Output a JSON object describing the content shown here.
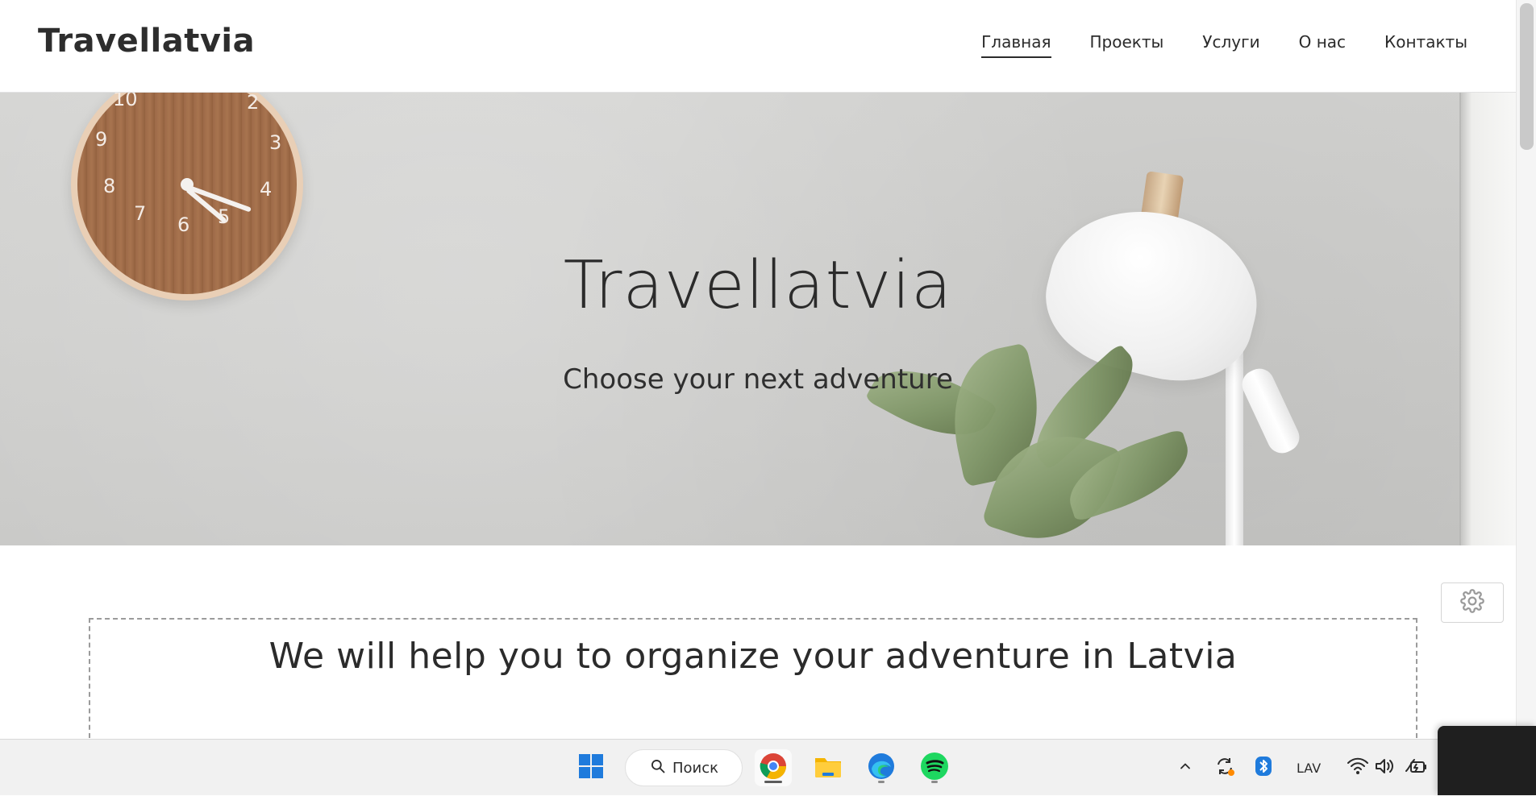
{
  "header": {
    "brand": "Travellatvia",
    "nav": [
      {
        "label": "Главная",
        "active": true
      },
      {
        "label": "Проекты",
        "active": false
      },
      {
        "label": "Услуги",
        "active": false
      },
      {
        "label": "О нас",
        "active": false
      },
      {
        "label": "Контакты",
        "active": false
      }
    ]
  },
  "hero": {
    "title": "Travellatvia",
    "subtitle": "Choose your next adventure",
    "clock_numbers": [
      "10",
      "2",
      "9",
      "3",
      "8",
      "4",
      "7",
      "6",
      "5"
    ]
  },
  "content": {
    "heading": "We will help you to organize your adventure in Latvia",
    "settings_icon": "gear-icon"
  },
  "taskbar": {
    "search_label": "Поиск",
    "apps": [
      "start-icon",
      "chrome-icon",
      "file-explorer-icon",
      "edge-icon",
      "spotify-icon"
    ],
    "tray": {
      "language": "LAV"
    }
  },
  "colors": {
    "text": "#2b2b2b",
    "hero_bg": "#cfcfcd",
    "taskbar_bg": "#f1f1f1",
    "accent_blue": "#1f7bdc",
    "spotify_green": "#1ed760"
  }
}
